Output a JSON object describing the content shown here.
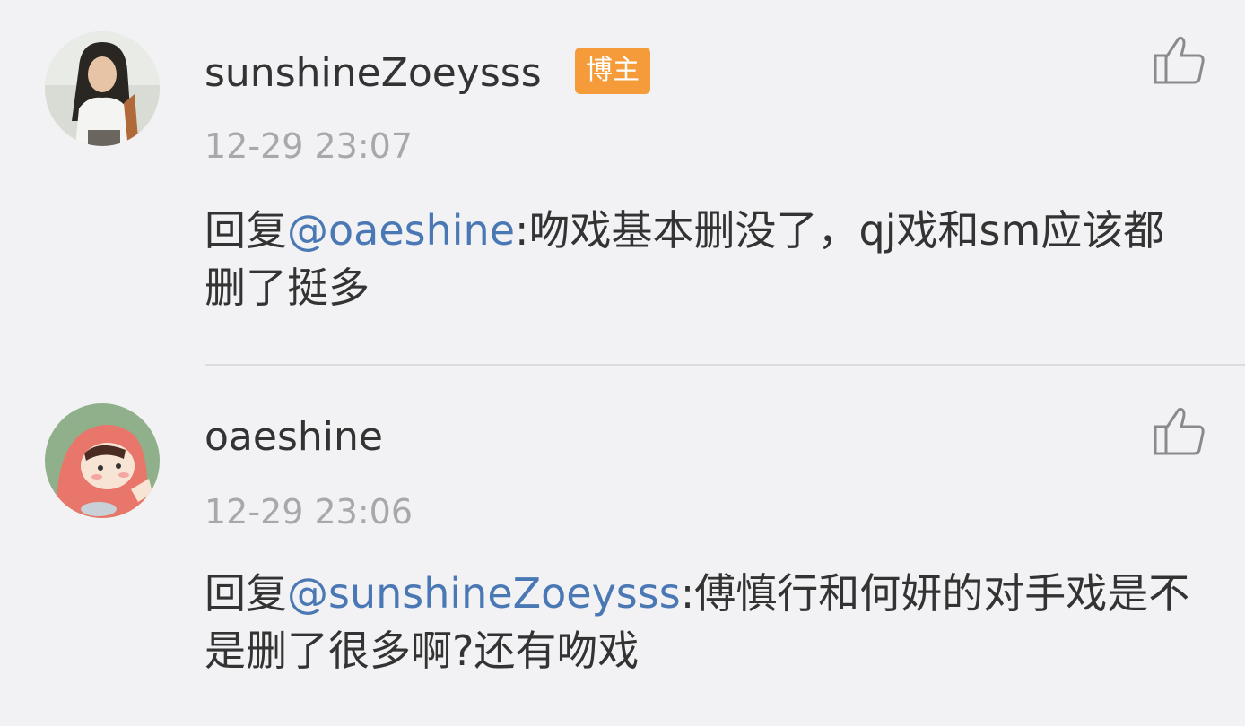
{
  "comments": [
    {
      "username": "sunshineZoeysss",
      "badge": "博主",
      "timestamp": "12-29 23:07",
      "reply_prefix": "回复",
      "mention": "@oaeshine",
      "text": ":吻戏基本删没了，qj戏和sm应该都删了挺多",
      "avatar_icon": "avatar-photo-icon",
      "like_icon": "thumbs-up-icon"
    },
    {
      "username": "oaeshine",
      "timestamp": "12-29 23:06",
      "reply_prefix": "回复",
      "mention": "@sunshineZoeysss",
      "text": ":傅慎行和何妍的对手戏是不是删了很多啊?还有吻戏",
      "avatar_icon": "avatar-cartoon-icon",
      "like_icon": "thumbs-up-icon"
    }
  ],
  "colors": {
    "background": "#f2f2f4",
    "badge": "#f59b3a",
    "mention": "#4a78b4",
    "timestamp": "#a8a8ac",
    "divider": "#dcdcdf"
  }
}
